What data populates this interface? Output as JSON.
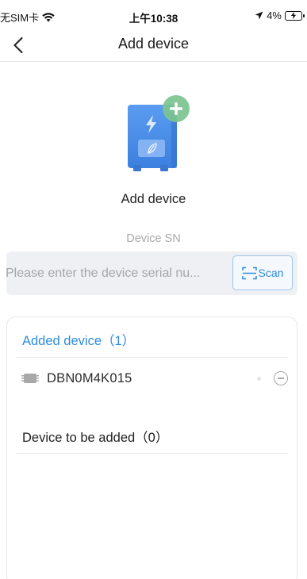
{
  "status_bar": {
    "carrier": "无SIM卡",
    "time": "上午10:38",
    "battery": "4%"
  },
  "nav": {
    "title": "Add device",
    "back_icon": "chevron-left-icon"
  },
  "illustration": {
    "icon": "device-add-icon",
    "colors": {
      "body": "#4a8fe8",
      "plus_badge": "#7cc48f"
    }
  },
  "add_section": {
    "title": "Add device",
    "sn_label": "Device SN",
    "input_placeholder": "Please enter the device serial nu...",
    "input_value": "",
    "scan_label": "Scan"
  },
  "devices": {
    "added_header": "Added device（1）",
    "added_list": [
      {
        "name": "DBN0M4K015",
        "icon": "device-chip-icon"
      }
    ],
    "pending_header": "Device to be added（0）",
    "pending_list": []
  },
  "colors": {
    "accent": "#2d8be0",
    "input_bg": "#eef0f3"
  }
}
